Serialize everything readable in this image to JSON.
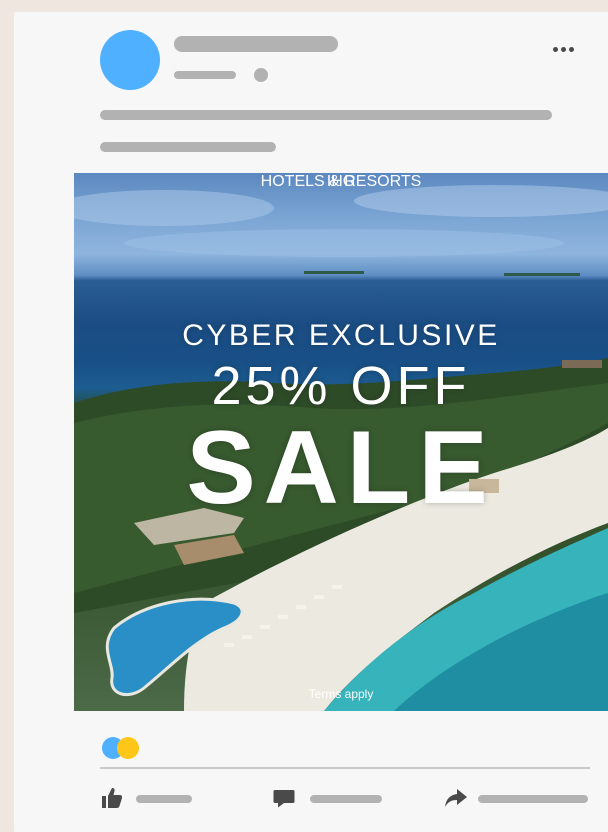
{
  "post": {
    "avatar_color": "#4fb0ff",
    "more_icon": "more-options-icon"
  },
  "ad": {
    "brand": "IHG",
    "brand_subtitle": "HOTELS & RESORTS",
    "headline": "CYBER EXCLUSIVE",
    "discount": "25% OFF",
    "sale": "SALE",
    "terms": "Terms apply"
  },
  "reactions": {
    "colors": [
      "#4fb0ff",
      "#ffc61a"
    ]
  },
  "actions": {
    "like_icon": "thumbs-up-icon",
    "comment_icon": "comment-icon",
    "share_icon": "share-icon",
    "icon_color": "#4a4a4a"
  },
  "placeholder_color": "#b2b2b2"
}
